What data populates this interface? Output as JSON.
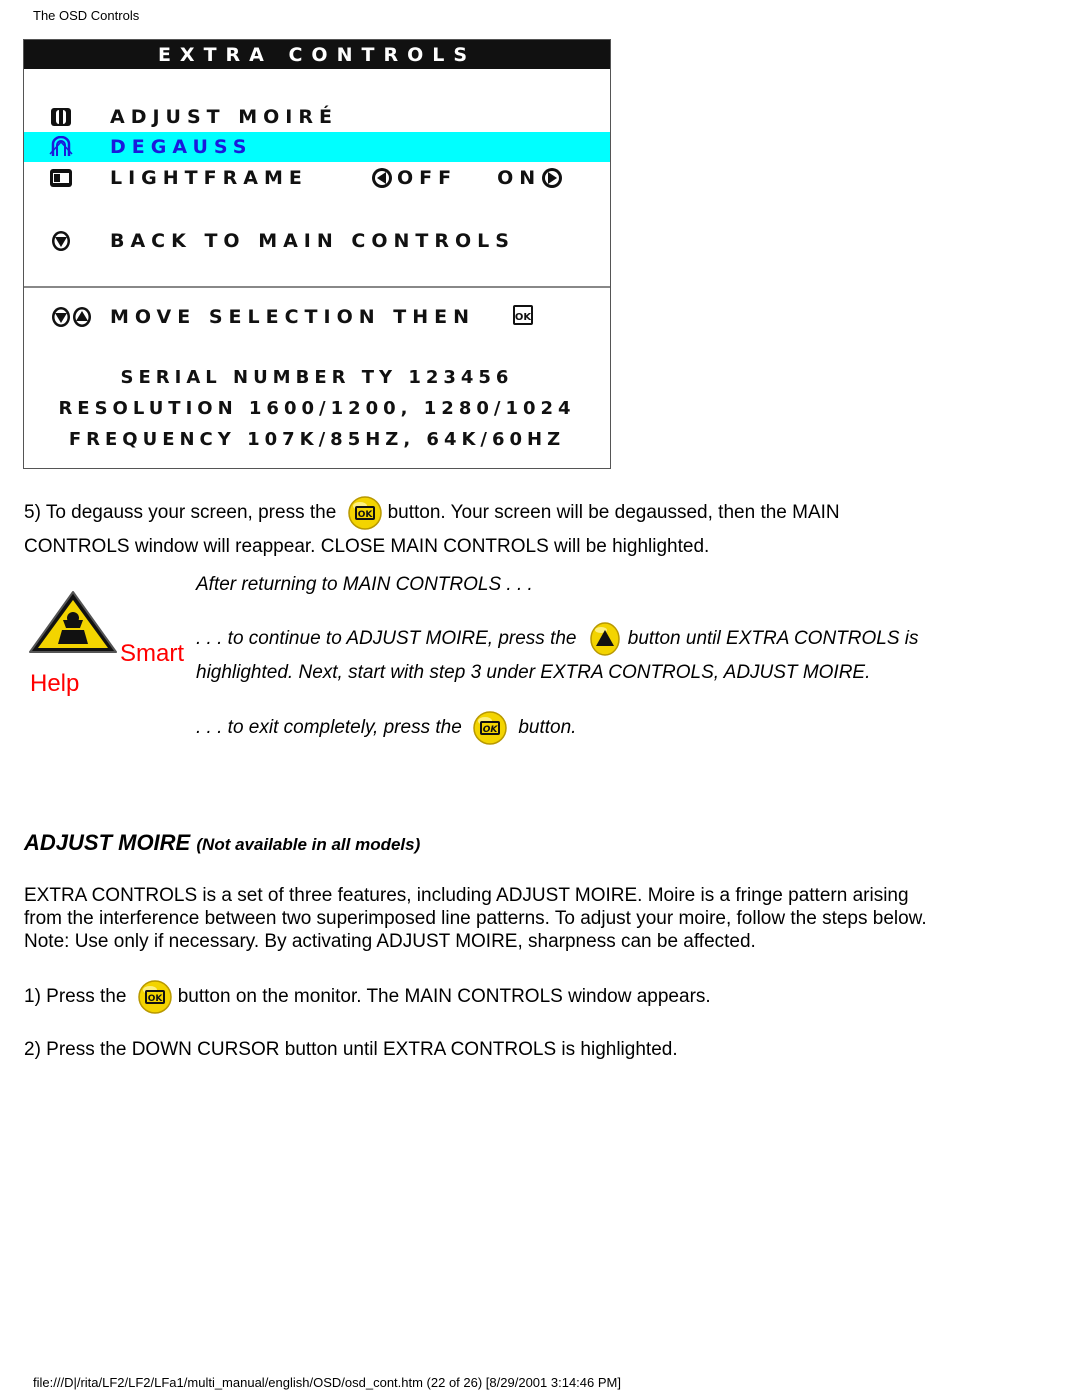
{
  "header": {
    "title": "The OSD Controls"
  },
  "osd": {
    "title": "EXTRA CONTROLS",
    "items": [
      {
        "label": "ADJUST MOIRÉ",
        "icon": "moire-icon",
        "highlighted": false
      },
      {
        "label": "DEGAUSS",
        "icon": "degauss-icon",
        "highlighted": true
      },
      {
        "label": "LIGHTFRAME",
        "icon": "lightframe-icon",
        "highlighted": false,
        "toggle": {
          "off_label": "OFF",
          "on_label": "ON"
        }
      },
      {
        "label": "BACK TO MAIN CONTROLS",
        "icon": "down-arrow-button-icon",
        "highlighted": false
      }
    ],
    "hint": {
      "text": "MOVE SELECTION THEN",
      "icons": [
        "down-arrow-button-icon",
        "up-arrow-button-icon",
        "ok-button-icon"
      ]
    },
    "info": {
      "serial": "SERIAL NUMBER TY 123456",
      "resolution": "RESOLUTION 1600/1200, 1280/1024",
      "frequency": "FREQUENCY 107K/85HZ, 64K/60HZ"
    },
    "colors": {
      "titlebar": "#111111",
      "highlight": "#00FFFF",
      "highlight_text": "#1A1ADC"
    }
  },
  "step5": {
    "before": "5) To degauss your screen, press the",
    "after": "button. Your screen will be degaussed, then the MAIN",
    "line2": "CONTROLS window will reappear. CLOSE MAIN CONTROLS will be highlighted."
  },
  "smart_help": {
    "smart": "Smart",
    "help": "Help",
    "after_returning": "After returning to MAIN CONTROLS . . .",
    "continue_before": ". . . to continue to ADJUST MOIRE, press the",
    "continue_after": "button until EXTRA CONTROLS is",
    "continue_line2": "highlighted. Next, start with step 3 under EXTRA CONTROLS, ADJUST MOIRE.",
    "exit_before": ". . . to exit completely, press the",
    "exit_after": "button."
  },
  "section": {
    "title": "ADJUST MOIRE",
    "subtitle": "(Not available in all models)",
    "intro_lines": [
      "EXTRA CONTROLS is a set of three features, including ADJUST MOIRE. Moire is a fringe pattern arising",
      "from the interference between two superimposed line patterns. To adjust your moire, follow the steps below.",
      "Note: Use only if necessary. By activating ADJUST MOIRE, sharpness can be affected."
    ],
    "step1_before": "1) Press the",
    "step1_after": "button on the monitor. The MAIN CONTROLS window appears.",
    "step2": "2) Press the DOWN CURSOR button until EXTRA CONTROLS is highlighted."
  },
  "footer": {
    "text": "file:///D|/rita/LF2/LF2/LFa1/multi_manual/english/OSD/osd_cont.htm (22 of 26) [8/29/2001 3:14:46 PM]"
  }
}
